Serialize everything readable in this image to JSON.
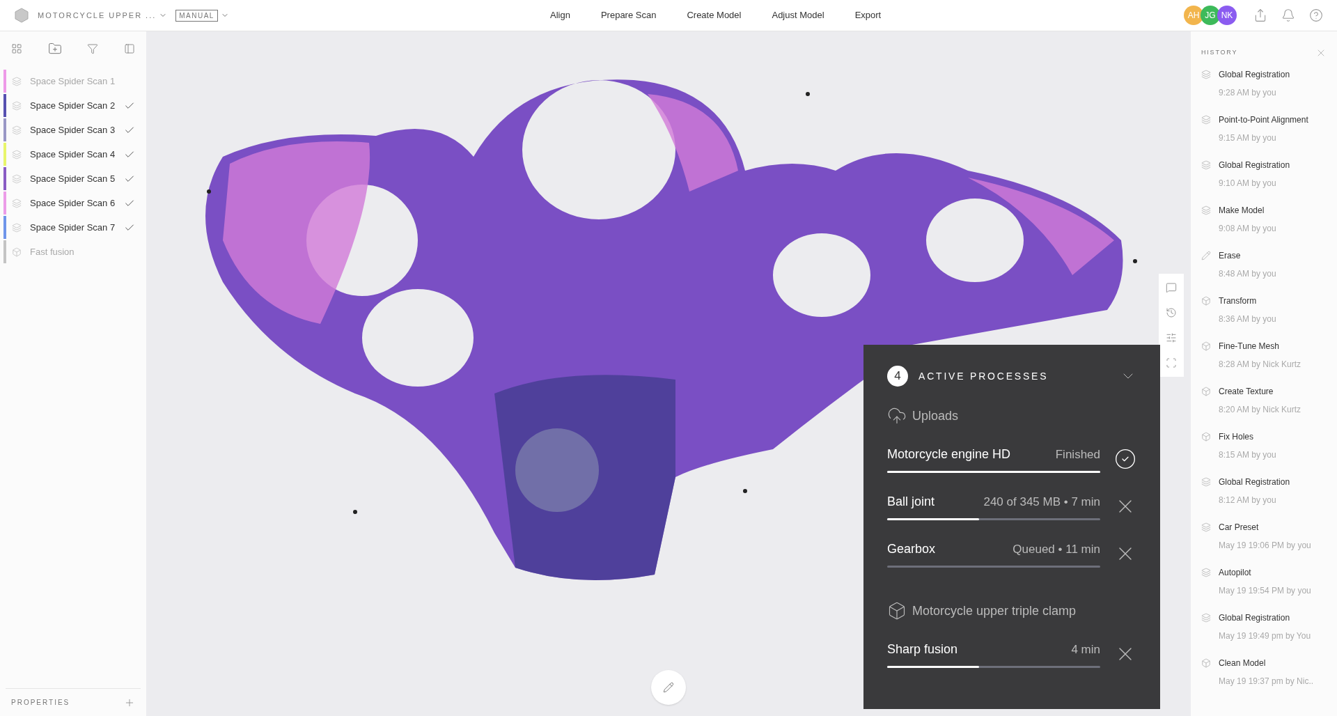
{
  "topbar": {
    "project": "MOTORCYCLE UPPER ...",
    "mode": "MANUAL",
    "nav": [
      {
        "label": "Align"
      },
      {
        "label": "Prepare Scan"
      },
      {
        "label": "Create Model"
      },
      {
        "label": "Adjust Model"
      },
      {
        "label": "Export"
      }
    ],
    "avatars": [
      {
        "initials": "AH",
        "color": "#f2b54d"
      },
      {
        "initials": "JG",
        "color": "#3dba5a"
      },
      {
        "initials": "NK",
        "color": "#8b5cf0"
      }
    ]
  },
  "sidebar": {
    "items": [
      {
        "kind": "scan",
        "name": "Space Spider Scan 1",
        "color": "#ee9ae8",
        "dimmed": true,
        "checked": false
      },
      {
        "kind": "scan",
        "name": "Space Spider Scan 2",
        "color": "#5650b0",
        "dimmed": false,
        "checked": true
      },
      {
        "kind": "scan",
        "name": "Space Spider Scan 3",
        "color": "#9a98c6",
        "dimmed": false,
        "checked": true
      },
      {
        "kind": "scan",
        "name": "Space Spider Scan 4",
        "color": "#e8f56a",
        "dimmed": false,
        "checked": true
      },
      {
        "kind": "scan",
        "name": "Space Spider Scan 5",
        "color": "#8a5cc4",
        "dimmed": false,
        "checked": true
      },
      {
        "kind": "scan",
        "name": "Space Spider Scan 6",
        "color": "#ec9ce8",
        "dimmed": false,
        "checked": true
      },
      {
        "kind": "scan",
        "name": "Space Spider Scan 7",
        "color": "#6f95ea",
        "dimmed": false,
        "checked": true
      },
      {
        "kind": "fusion",
        "name": "Fast fusion",
        "color": "#c4c4c4",
        "dimmed": true,
        "checked": false
      }
    ],
    "properties": "PROPERTIES"
  },
  "processes": {
    "count": "4",
    "title": "ACTIVE PROCESSES",
    "groups": [
      {
        "kind": "upload",
        "label": "Uploads",
        "items": [
          {
            "name": "Motorcycle engine HD",
            "status": "Finished",
            "level": 1,
            "finished": true
          },
          {
            "name": "Ball joint",
            "status": "240 of 345 MB • 7 min",
            "level": 0.43,
            "finished": false
          },
          {
            "name": "Gearbox",
            "status": "Queued • 11 min",
            "level": 0,
            "finished": false
          }
        ]
      },
      {
        "kind": "model",
        "label": "Motorcycle upper triple clamp",
        "items": [
          {
            "name": "Sharp fusion",
            "status": "4 min",
            "level": 0.43,
            "finished": false
          }
        ]
      }
    ]
  },
  "history": {
    "title": "HISTORY",
    "items": [
      {
        "kind": "layers",
        "title": "Global Registration",
        "meta": "9:28 AM by you"
      },
      {
        "kind": "layers",
        "title": "Point-to-Point Alignment",
        "meta": "9:15 AM by you"
      },
      {
        "kind": "layers",
        "title": "Global Registration",
        "meta": "9:10 AM by you"
      },
      {
        "kind": "layers",
        "title": "Make Model",
        "meta": "9:08 AM by you"
      },
      {
        "kind": "pencil",
        "title": "Erase",
        "meta": "8:48 AM by you"
      },
      {
        "kind": "cube",
        "title": "Transform",
        "meta": "8:36 AM by you"
      },
      {
        "kind": "cube",
        "title": "Fine-Tune Mesh",
        "meta": "8:28 AM by Nick Kurtz"
      },
      {
        "kind": "cube",
        "title": "Create Texture",
        "meta": "8:20 AM by Nick Kurtz"
      },
      {
        "kind": "cube",
        "title": "Fix Holes",
        "meta": "8:15 AM by you"
      },
      {
        "kind": "layers",
        "title": "Global Registration",
        "meta": "8:12 AM by you"
      },
      {
        "kind": "layers",
        "title": "Car Preset",
        "meta": "May 19 19:06 PM by you"
      },
      {
        "kind": "layers",
        "title": "Autopilot",
        "meta": "May 19 19:54 PM by you"
      },
      {
        "kind": "layers",
        "title": "Global Registration",
        "meta": "May 19 19:49 pm by You"
      },
      {
        "kind": "cube",
        "title": "Clean Model",
        "meta": "May 19 19:37 pm by Nic.."
      }
    ]
  }
}
